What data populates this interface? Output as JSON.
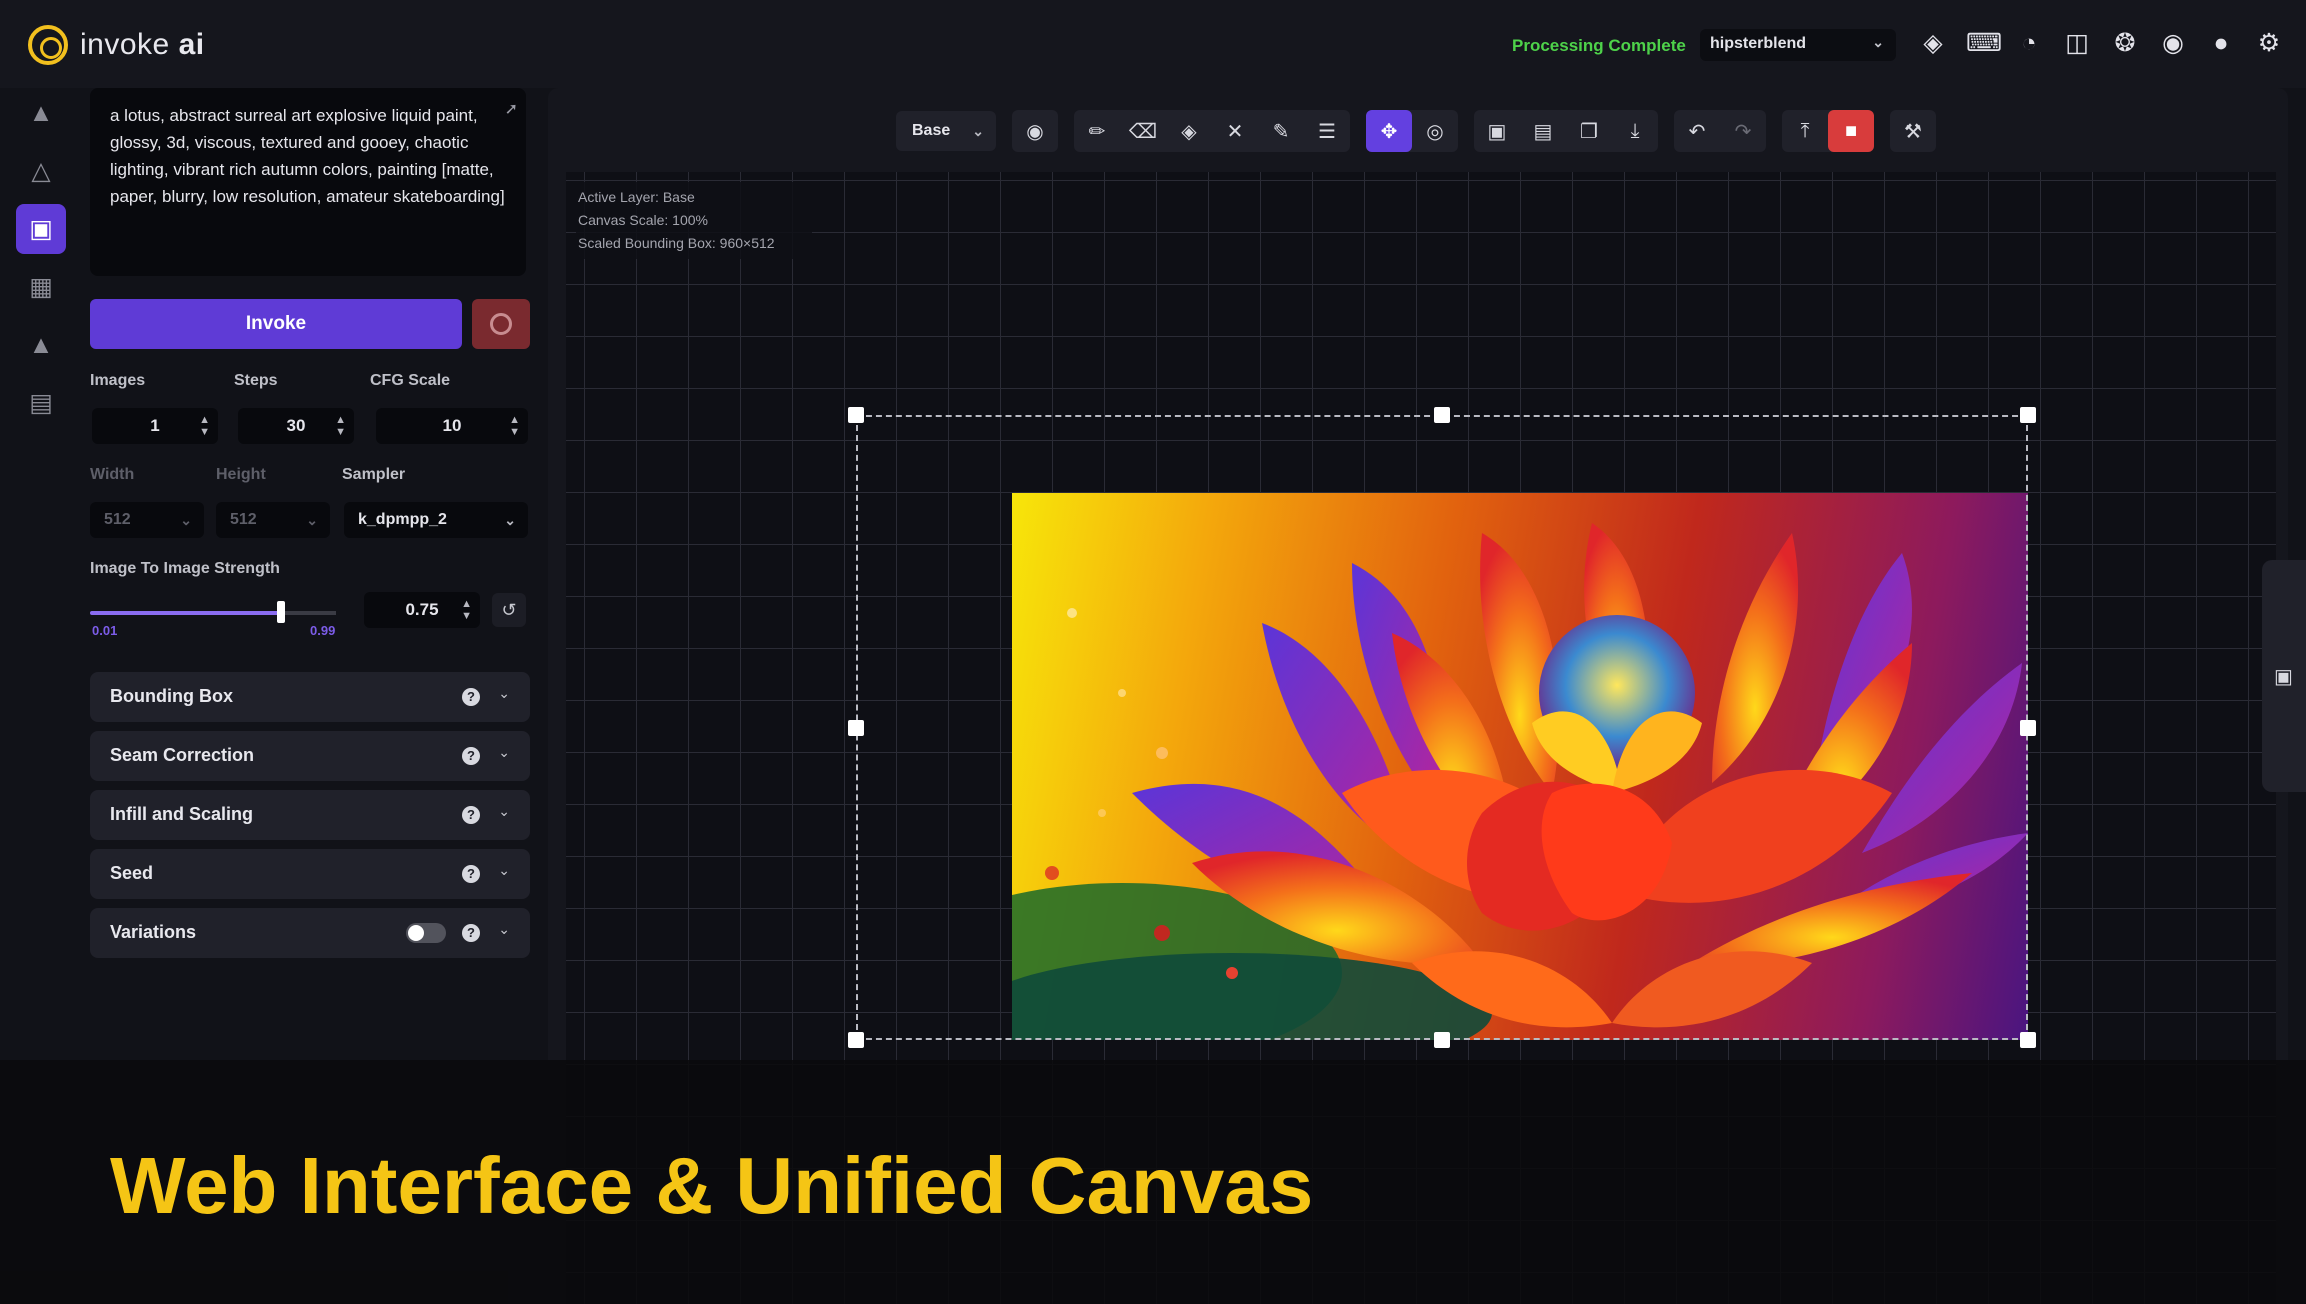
{
  "header": {
    "brand_prefix": "invoke",
    "brand_suffix": "ai",
    "status": "Processing Complete",
    "model": "hipsterblend",
    "icons": [
      "cube-icon",
      "keyboard-icon",
      "palette-icon",
      "language-icon",
      "bug-icon",
      "github-icon",
      "discord-icon",
      "gear-icon"
    ]
  },
  "tabs": [
    "text-to-image",
    "image-to-image",
    "unified-canvas",
    "nodes",
    "postprocessing",
    "training"
  ],
  "options": {
    "prompt": "a lotus, abstract surreal art explosive liquid paint, glossy, 3d, viscous, textured and gooey, chaotic lighting, vibrant rich autumn colors, painting [matte, paper, blurry, low resolution, amateur skateboarding]",
    "invoke_label": "Invoke",
    "images": {
      "label": "Images",
      "value": "1"
    },
    "steps": {
      "label": "Steps",
      "value": "30"
    },
    "cfg": {
      "label": "CFG Scale",
      "value": "10"
    },
    "width": {
      "label": "Width",
      "value": "512"
    },
    "height": {
      "label": "Height",
      "value": "512"
    },
    "sampler": {
      "label": "Sampler",
      "value": "k_dpmpp_2"
    },
    "strength": {
      "label": "Image To Image Strength",
      "value": "0.75",
      "fraction": 0.75,
      "min": "0.01",
      "max": "0.99"
    },
    "accordions": [
      "Bounding Box",
      "Seam Correction",
      "Infill and Scaling",
      "Seed",
      "Variations"
    ]
  },
  "canvas": {
    "layer": "Base",
    "info": [
      "Active Layer: Base",
      "Canvas Scale: 100%",
      "Scaled Bounding Box: 960×512"
    ]
  },
  "banner": {
    "title": "Web Interface & Unified Canvas"
  }
}
